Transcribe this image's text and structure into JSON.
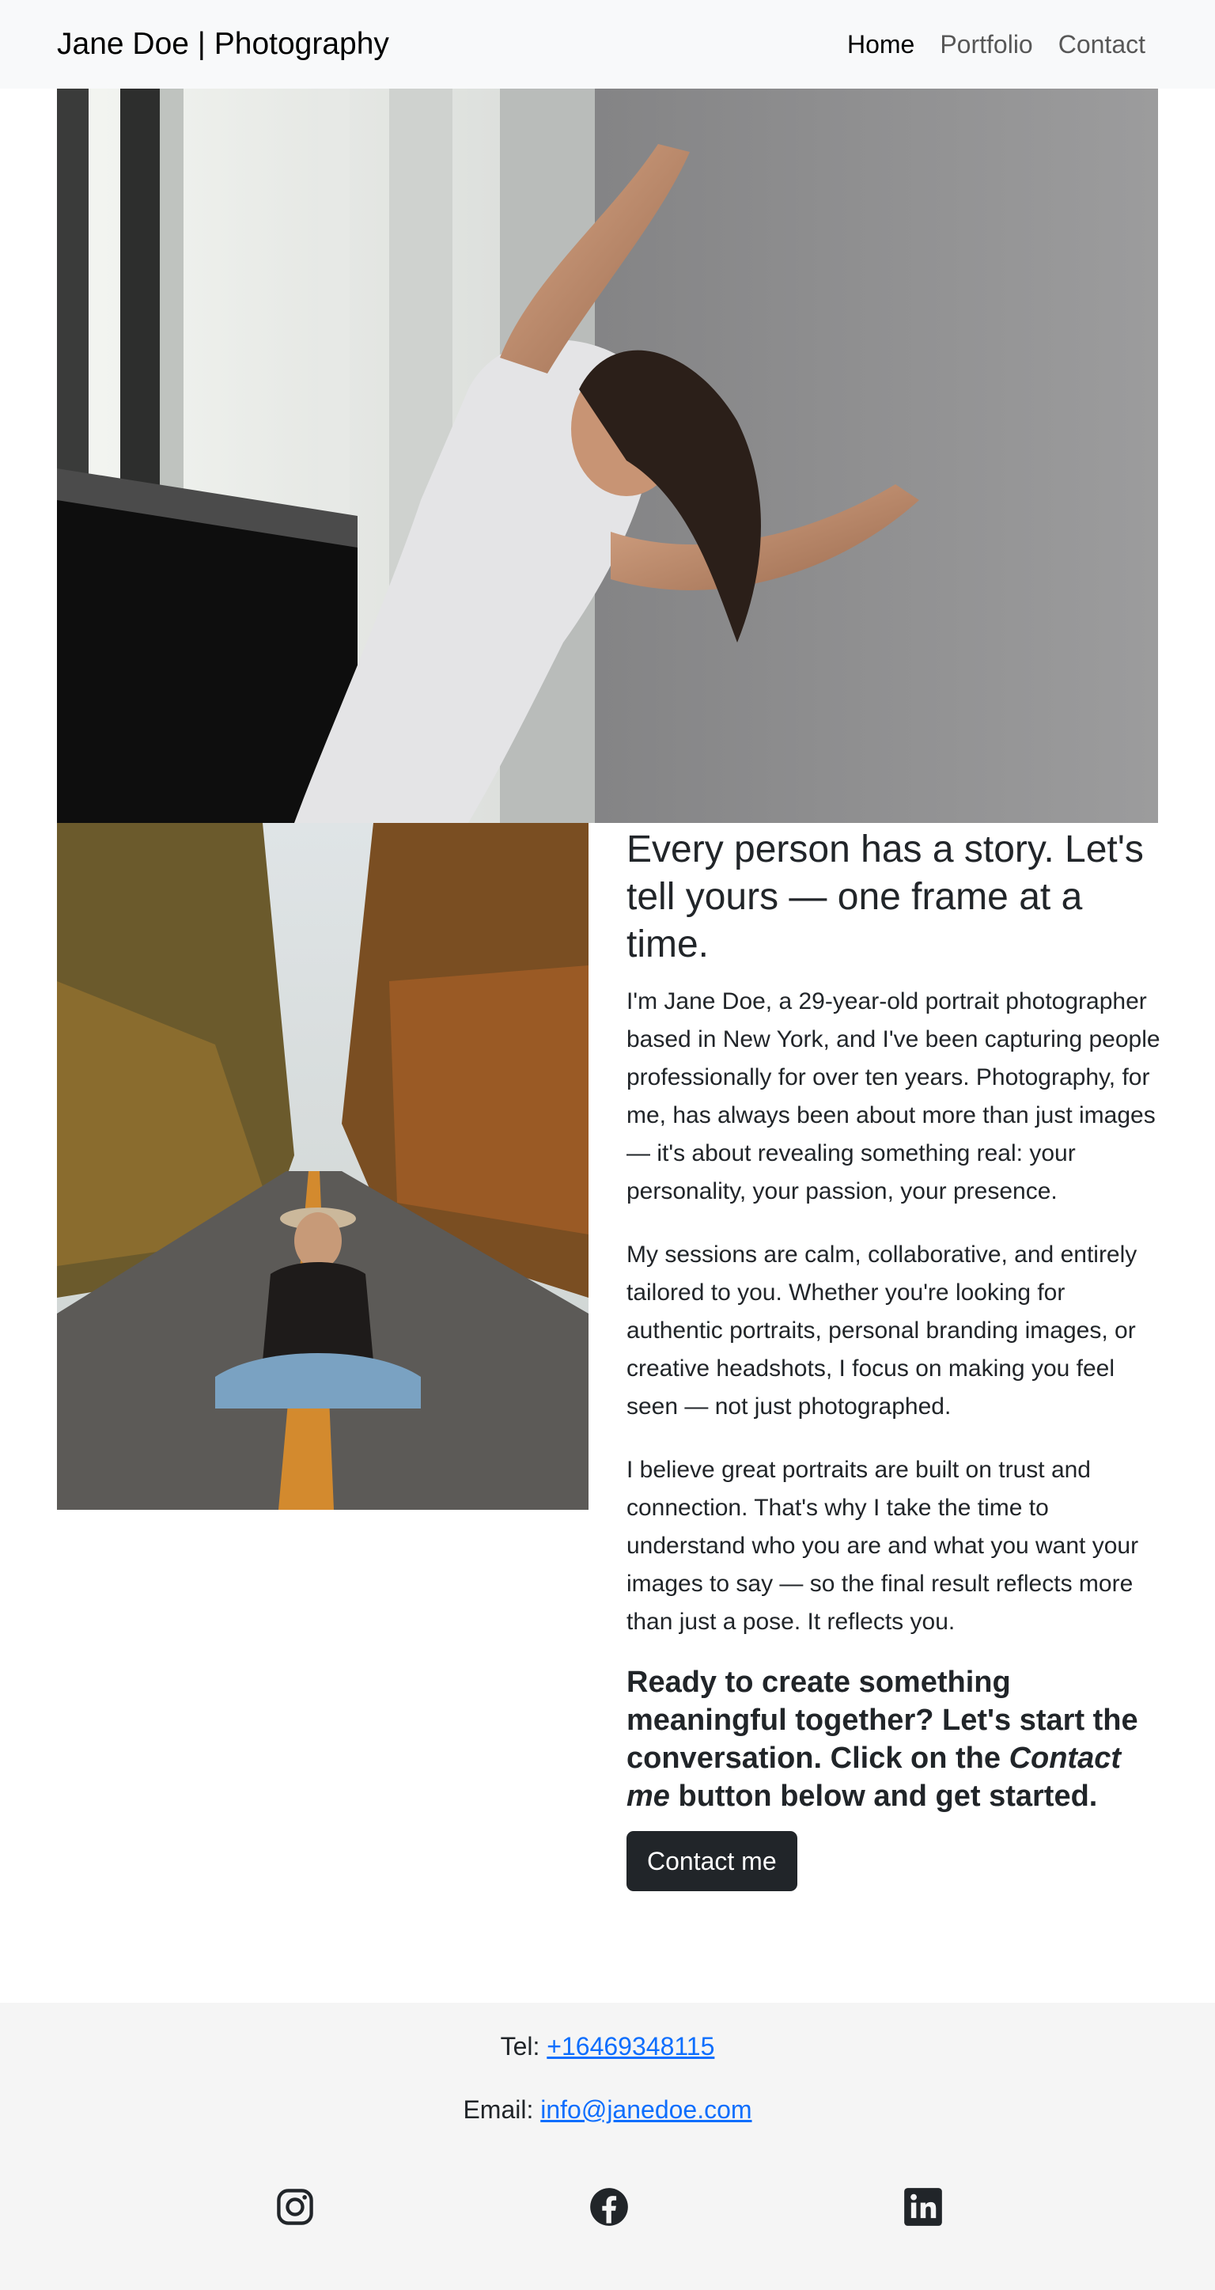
{
  "navbar": {
    "brand": "Jane Doe | Photography",
    "links": [
      {
        "label": "Home",
        "active": true
      },
      {
        "label": "Portfolio",
        "active": false
      },
      {
        "label": "Contact",
        "active": false
      }
    ]
  },
  "about": {
    "headline": "Every person has a story. Let's tell yours — one frame at a time.",
    "paragraphs": [
      "I'm Jane Doe, a 29-year-old portrait photographer based in New York, and I've been capturing people professionally for over ten years. Photography, for me, has always been about more than just images — it's about revealing something real: your personality, your passion, your presence.",
      "My sessions are calm, collaborative, and entirely tailored to you. Whether you're looking for authentic portraits, personal branding images, or creative headshots, I focus on making you feel seen — not just photographed.",
      "I believe great portraits are built on trust and connection. That's why I take the time to understand who you are and what you want your images to say — so the final result reflects more than just a pose. It reflects you."
    ],
    "cta_before": "Ready to create something meaningful together? Let's start the conversation. Click on the ",
    "cta_emphasis": "Contact me",
    "cta_after": " button below and get started.",
    "button_label": "Contact me"
  },
  "footer": {
    "tel_label": "Tel: ",
    "tel_value": "+16469348115",
    "email_label": "Email: ",
    "email_value": "info@janedoe.com"
  },
  "icons": {
    "social": [
      "instagram-icon",
      "facebook-icon",
      "linkedin-icon"
    ]
  }
}
